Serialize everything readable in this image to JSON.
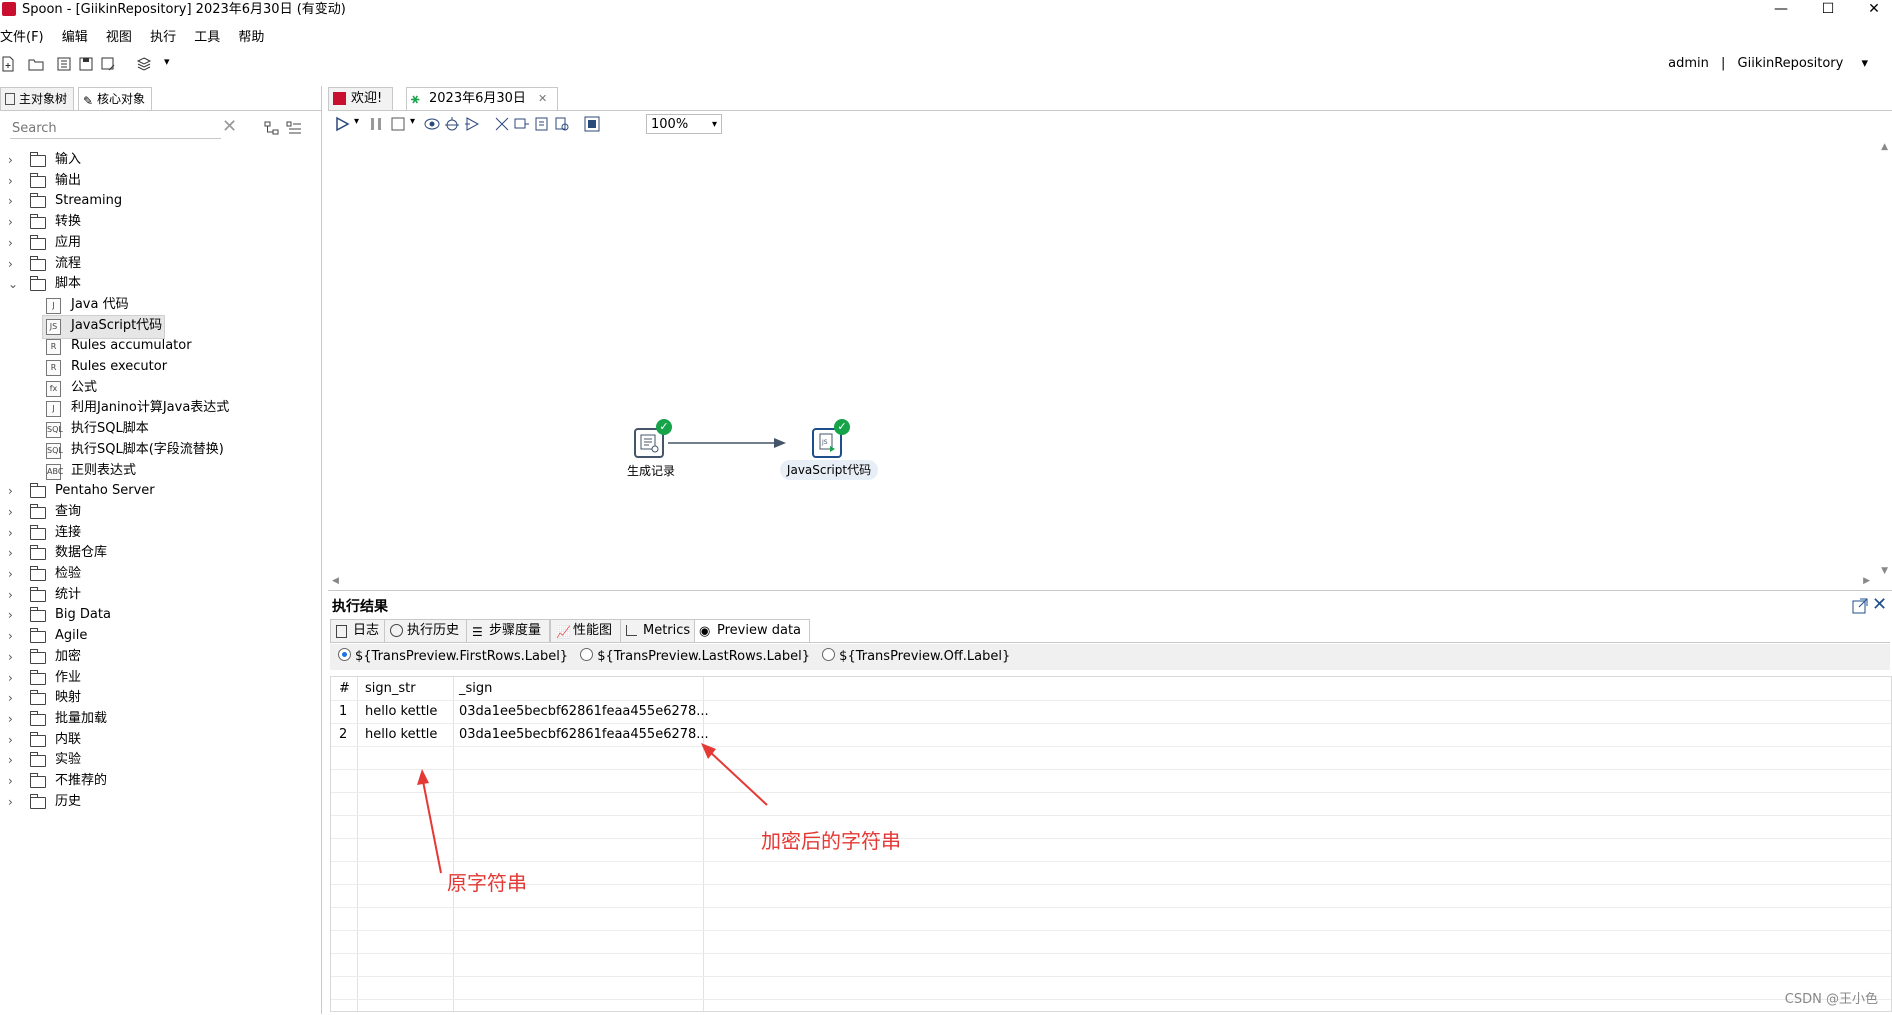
{
  "window": {
    "title": "Spoon - [GiikinRepository] 2023年6月30日 (有变动)",
    "controls": {
      "minimize": "—",
      "maximize": "☐",
      "close": "✕"
    }
  },
  "menu": [
    "文件(F)",
    "编辑",
    "视图",
    "执行",
    "工具",
    "帮助"
  ],
  "user": {
    "name": "admin",
    "separator": "|",
    "repository": "GiikinRepository",
    "dropdown": "▾"
  },
  "left_panel": {
    "tabs": [
      "主对象树",
      "核心对象"
    ],
    "search_placeholder": "Search",
    "tree": [
      {
        "label": "输入",
        "expanded": false
      },
      {
        "label": "输出",
        "expanded": false
      },
      {
        "label": "Streaming",
        "expanded": false
      },
      {
        "label": "转换",
        "expanded": false
      },
      {
        "label": "应用",
        "expanded": false
      },
      {
        "label": "流程",
        "expanded": false
      },
      {
        "label": "脚本",
        "expanded": true
      },
      {
        "label": "Java 代码",
        "child": true
      },
      {
        "label": "JavaScript代码",
        "child": true,
        "selected": true
      },
      {
        "label": "Rules accumulator",
        "child": true
      },
      {
        "label": "Rules executor",
        "child": true
      },
      {
        "label": "公式",
        "child": true
      },
      {
        "label": "利用Janino计算Java表达式",
        "child": true
      },
      {
        "label": "执行SQL脚本",
        "child": true
      },
      {
        "label": "执行SQL脚本(字段流替换)",
        "child": true
      },
      {
        "label": "正则表达式",
        "child": true
      },
      {
        "label": "Pentaho Server",
        "expanded": false
      },
      {
        "label": "查询",
        "expanded": false
      },
      {
        "label": "连接",
        "expanded": false
      },
      {
        "label": "数据仓库",
        "expanded": false
      },
      {
        "label": "检验",
        "expanded": false
      },
      {
        "label": "统计",
        "expanded": false
      },
      {
        "label": "Big Data",
        "expanded": false
      },
      {
        "label": "Agile",
        "expanded": false
      },
      {
        "label": "加密",
        "expanded": false
      },
      {
        "label": "作业",
        "expanded": false
      },
      {
        "label": "映射",
        "expanded": false
      },
      {
        "label": "批量加载",
        "expanded": false
      },
      {
        "label": "内联",
        "expanded": false
      },
      {
        "label": "实验",
        "expanded": false
      },
      {
        "label": "不推荐的",
        "expanded": false
      },
      {
        "label": "历史",
        "expanded": false
      }
    ]
  },
  "doc_tabs": [
    "欢迎!",
    "2023年6月30日"
  ],
  "zoom": "100%",
  "canvas": {
    "steps": [
      {
        "label": "生成记录",
        "icon": "generate-rows-icon"
      },
      {
        "label": "JavaScript代码",
        "icon": "javascript-icon"
      }
    ]
  },
  "results": {
    "title": "执行结果",
    "tabs": [
      "日志",
      "执行历史",
      "步骤度量",
      "性能图",
      "Metrics",
      "Preview data"
    ],
    "radios": [
      "${TransPreview.FirstRows.Label}",
      "${TransPreview.LastRows.Label}",
      "${TransPreview.Off.Label}"
    ],
    "columns": [
      "#",
      "sign_str",
      "_sign"
    ],
    "rows": [
      [
        "1",
        "hello kettle",
        "03da1ee5becbf62861feaa455e6278..."
      ],
      [
        "2",
        "hello kettle",
        "03da1ee5becbf62861feaa455e6278..."
      ]
    ]
  },
  "annotations": {
    "original": "原字符串",
    "encrypted": "加密后的字符串"
  },
  "watermark": "CSDN @王小色",
  "colors": {
    "accent": "#1a73e8",
    "success": "#16a34a",
    "annotation": "#e53935"
  }
}
